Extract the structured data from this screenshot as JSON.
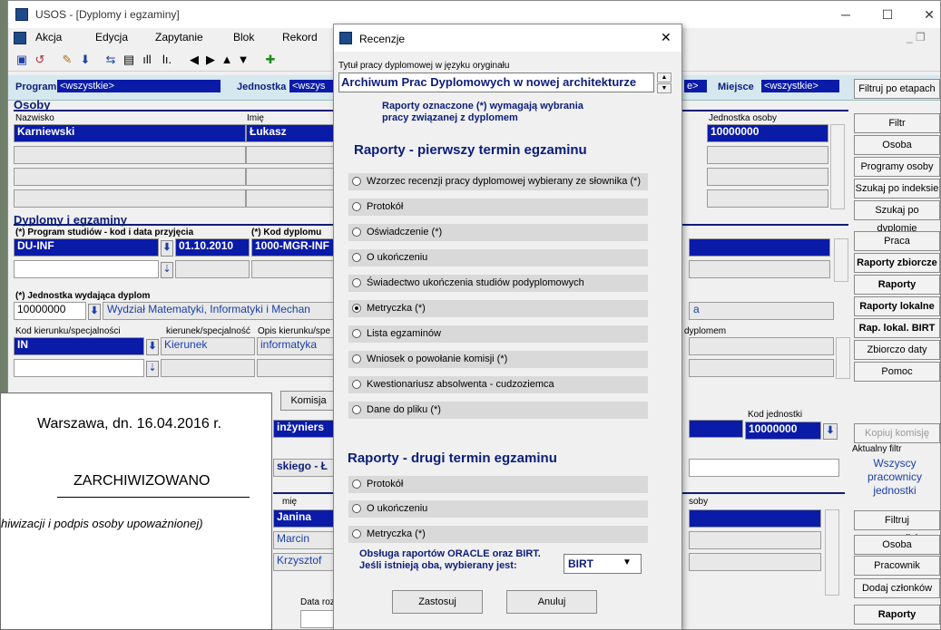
{
  "app": {
    "title": "USOS - [Dyplomy i egzaminy]"
  },
  "menu": [
    "Akcja",
    "Edycja",
    "Zapytanie",
    "Blok",
    "Rekord"
  ],
  "filter": {
    "program_label": "Program",
    "program_value": "<wszystkie>",
    "jednostka_label": "Jednostka",
    "jednostka_value": "<wszys",
    "extra_value": "e>",
    "miejsce_label": "Miejsce",
    "miejsce_value": "<wszystkie>"
  },
  "osoby": {
    "title": "Osoby",
    "col_nazwisko": "Nazwisko",
    "col_imie": "Imię",
    "col_jednostka": "Jednostka osoby",
    "nazwisko": "Karniewski",
    "imie": "Łukasz",
    "jednostka": "10000000"
  },
  "dyplomy": {
    "title": "Dyplomy i egzaminy",
    "col_program": "(*) Program studiów - kod i data przyjęcia",
    "col_kod": "(*) Kod dyplomu",
    "program": "DU-INF",
    "data": "01.10.2010",
    "kod": "1000-MGR-INF",
    "jednostka_label": "(*) Jednostka wydająca dyplom",
    "jednostka_kod": "10000000",
    "jednostka_nazwa": "Wydział Matematyki, Informatyki i Mechan",
    "jednostka_tail": "a",
    "kier_label": "Kod kierunku/specjalności",
    "kier_label2": "kierunek/specjalność",
    "kier_label3": "Opis kierunku/spe",
    "kier_kod": "IN",
    "kier_typ": "Kierunek",
    "kier_opis": "informatyka",
    "dyplomem": "dyplomem"
  },
  "komisja": {
    "tab": "Komisja",
    "kod_jednostki_label": "Kod jednostki",
    "kod_jednostki": "10000000",
    "frag1": "inżyniers",
    "frag2": "skiego - Ł",
    "col_imie": "mię",
    "col_osoby": "soby",
    "imie1": "Janina",
    "imie2": "Marcin",
    "imie3": "Krzysztof",
    "data_label": "Data roz"
  },
  "right_buttons_top": [
    "Filtruj po etapach"
  ],
  "right_buttons_1": [
    "Filtr",
    "Osoba",
    "Programy osoby",
    "Szukaj po indeksie",
    "Szukaj po dyplomie"
  ],
  "right_buttons_2": [
    "Praca",
    "Raporty zbiorcze",
    "Raporty",
    "Raporty lokalne",
    "Rap. lokal. BIRT",
    "Zbiorczo daty",
    "Pomoc"
  ],
  "right_buttons_3": {
    "kopiuj": "Kopiuj komisję",
    "aktualny_label": "Aktualny filtr",
    "aktualny_value": "Wszyscy pracownicy jednostki",
    "list": [
      "Filtruj pracowników",
      "Osoba",
      "Pracownik",
      "Dodaj członków",
      "Raporty"
    ]
  },
  "paper": {
    "date": "Warszawa, dn. 16.04.2016 r.",
    "status": "ZARCHIWIZOWANO",
    "note": "hiwizacji i podpis osoby upoważnionej)"
  },
  "dialog": {
    "title": "Recenzje",
    "close": "✕",
    "field_label": "Tytuł pracy dyplomowej w języku oryginału",
    "field_value": "Archiwum Prac Dyplomowych w nowej architekturze",
    "note": "Raporty oznaczone (*) wymagają wybrania pracy związanej z dyplomem",
    "h1": "Raporty - pierwszy termin egzaminu",
    "options1": [
      "Wzorzec recenzji pracy dyplomowej wybierany ze słownika (*)",
      "Protokół",
      "Oświadczenie (*)",
      "O ukończeniu",
      "Świadectwo ukończenia studiów podyplomowych",
      "Metryczka (*)",
      "Lista egzaminów",
      "Wniosek o powołanie komisji (*)",
      "Kwestionariusz absolwenta - cudzoziemca",
      "Dane do pliku (*)"
    ],
    "selected_index": 5,
    "h2": "Raporty - drugi termin egzaminu",
    "options2": [
      "Protokół",
      "O ukończeniu",
      "Metryczka (*)"
    ],
    "birt_label1": "Obsługa raportów ORACLE oraz BIRT.",
    "birt_label2": "Jeśli istnieją oba, wybierany jest:",
    "birt_value": "BIRT",
    "btn_apply": "Zastosuj",
    "btn_cancel": "Anuluj"
  }
}
